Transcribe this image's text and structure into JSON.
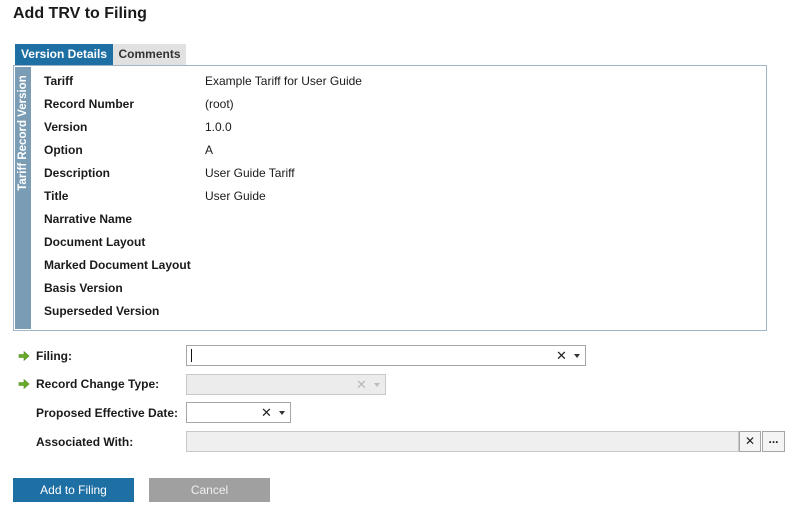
{
  "dialog": {
    "title": "Add TRV to Filing"
  },
  "tabs": [
    {
      "label": "Version Details",
      "active": true
    },
    {
      "label": "Comments",
      "active": false
    }
  ],
  "panel": {
    "sidebar_label": "Tariff Record Version",
    "properties": [
      {
        "label": "Tariff",
        "value": "Example Tariff for User Guide"
      },
      {
        "label": "Record Number",
        "value": "(root)"
      },
      {
        "label": "Version",
        "value": "1.0.0"
      },
      {
        "label": "Option",
        "value": "A"
      },
      {
        "label": "Description",
        "value": "User Guide Tariff"
      },
      {
        "label": "Title",
        "value": "User Guide"
      },
      {
        "label": "Narrative Name",
        "value": ""
      },
      {
        "label": "Document Layout",
        "value": ""
      },
      {
        "label": "Marked Document Layout",
        "value": ""
      },
      {
        "label": "Basis Version",
        "value": ""
      },
      {
        "label": "Superseded Version",
        "value": ""
      }
    ]
  },
  "form": {
    "filing": {
      "label": "Filing:",
      "value": "",
      "clear": "✕",
      "required": true
    },
    "record_change_type": {
      "label": "Record Change Type:",
      "value": "",
      "clear": "✕",
      "required": true
    },
    "proposed_effective_date": {
      "label": "Proposed Effective Date:",
      "value": "",
      "clear": "✕"
    },
    "associated_with": {
      "label": "Associated With:",
      "value": "",
      "clear": "✕",
      "browse": "..."
    }
  },
  "buttons": {
    "add": "Add to Filing",
    "cancel": "Cancel"
  },
  "colors": {
    "accent": "#1e6fa3",
    "sidebar": "#7b9cb5",
    "required_arrow": "#6aaa2a"
  }
}
